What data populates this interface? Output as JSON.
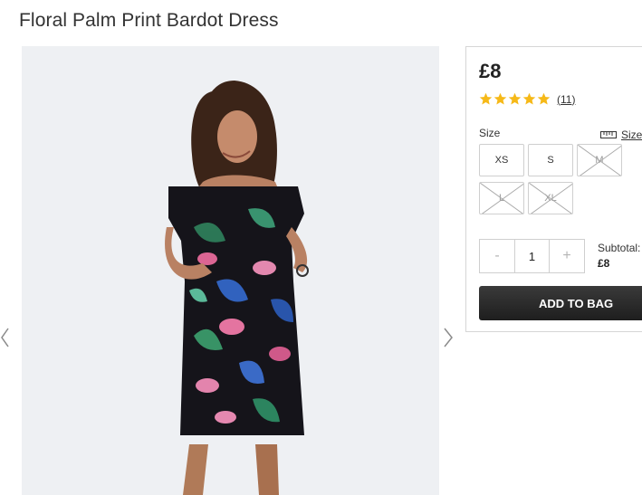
{
  "product": {
    "title": "Floral Palm Print Bardot Dress",
    "price": "£8",
    "rating_stars": 5,
    "review_count": "(11)"
  },
  "sizes": {
    "label": "Size",
    "guide_label": "Size",
    "options": [
      {
        "label": "XS",
        "available": true
      },
      {
        "label": "S",
        "available": true
      },
      {
        "label": "M",
        "available": false
      },
      {
        "label": "L",
        "available": false
      },
      {
        "label": "XL",
        "available": false
      }
    ]
  },
  "quantity": {
    "minus": "-",
    "value": "1",
    "plus": "+"
  },
  "subtotal": {
    "label": "Subtotal:",
    "value": "£8"
  },
  "cart": {
    "add_label": "ADD TO BAG"
  },
  "colors": {
    "star": "#f6b918",
    "button": "#2a2a2a",
    "border": "#d6d6d6"
  }
}
